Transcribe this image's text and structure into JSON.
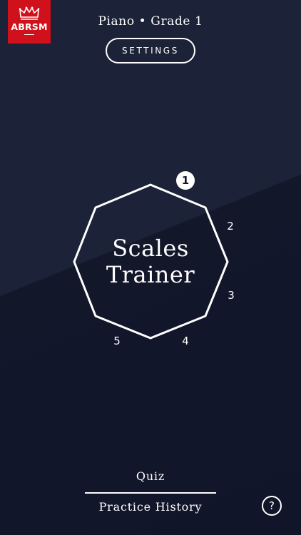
{
  "logo": {
    "brand": "ABRSM",
    "icon": "crown-icon",
    "color": "#d0101a"
  },
  "header": {
    "subtitle": "Piano • Grade 1",
    "settings_label": "SETTINGS"
  },
  "hero": {
    "title_line1": "Scales",
    "title_line2": "Trainer"
  },
  "steps": [
    {
      "label": "1",
      "active": true
    },
    {
      "label": "2",
      "active": false
    },
    {
      "label": "3",
      "active": false
    },
    {
      "label": "4",
      "active": false
    },
    {
      "label": "5",
      "active": false
    }
  ],
  "nav": {
    "quiz_label": "Quiz",
    "history_label": "Practice History",
    "help_label": "?"
  },
  "colors": {
    "background": "#11152a",
    "accent": "#ffffff"
  }
}
